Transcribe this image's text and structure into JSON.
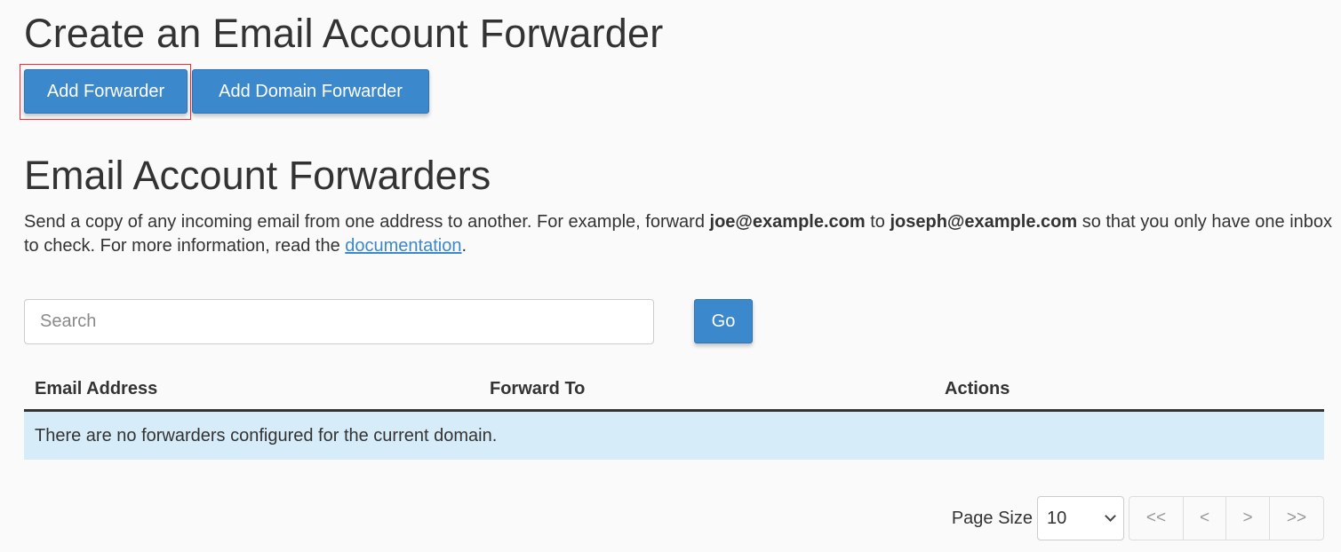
{
  "header": {
    "title": "Create an Email Account Forwarder"
  },
  "actions": {
    "add_forwarder_label": "Add Forwarder",
    "add_domain_forwarder_label": "Add Domain Forwarder"
  },
  "section": {
    "title": "Email Account Forwarders",
    "description": {
      "part1": "Send a copy of any incoming email from one address to another. For example, forward ",
      "example_from": "joe@example.com",
      "part2": " to ",
      "example_to": "joseph@example.com",
      "part3": " so that you only have one inbox to check. For more information, read the ",
      "link_text": "documentation",
      "part4": "."
    }
  },
  "search": {
    "placeholder": "Search",
    "value": "",
    "go_label": "Go"
  },
  "table": {
    "columns": [
      "Email Address",
      "Forward To",
      "Actions"
    ],
    "rows": [],
    "empty_message": "There are no forwarders configured for the current domain."
  },
  "pagination": {
    "page_size_label": "Page Size",
    "page_size_value": "10",
    "first_label": "<<",
    "prev_label": "<",
    "next_label": ">",
    "last_label": ">>"
  },
  "colors": {
    "primary": "#3b88cd",
    "highlight_border": "#e5333b",
    "info_row": "#d7ecf9",
    "text": "#333333"
  }
}
